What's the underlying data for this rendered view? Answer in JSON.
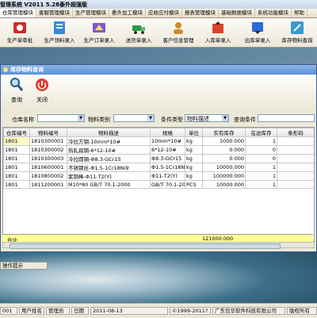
{
  "app": {
    "title": "管理系统  V2011 5.28泰外超强版"
  },
  "menu": {
    "tabs": [
      {
        "label": "仓库管理模块",
        "active": true
      },
      {
        "label": "客服管理模块",
        "active": false
      },
      {
        "label": "生产管理模块",
        "active": false
      },
      {
        "label": "委外加工模块",
        "active": false
      },
      {
        "label": "应收应付模块",
        "active": false
      },
      {
        "label": "报表管理模块",
        "active": false
      },
      {
        "label": "基础数据模块",
        "active": false
      },
      {
        "label": "系统功能模块",
        "active": false
      },
      {
        "label": "帮助",
        "active": false
      }
    ]
  },
  "toolbar": {
    "buttons": [
      {
        "label": "生产单审批",
        "icon": "approval-icon",
        "color": "#d02a2a"
      },
      {
        "label": "生产领料录入",
        "icon": "pick-material-icon",
        "color": "#3a8ad9"
      },
      {
        "label": "生产订单录入",
        "icon": "production-order-icon",
        "color": "#7a5ad0"
      },
      {
        "label": "送货单录入",
        "icon": "delivery-icon",
        "color": "#2d9a4a"
      },
      {
        "label": "客户信息管理",
        "icon": "customer-icon",
        "color": "#cc8a2a"
      },
      {
        "label": "入库单录入",
        "icon": "stock-in-icon",
        "color": "#d9442a"
      },
      {
        "label": "出库单录入",
        "icon": "stock-out-icon",
        "color": "#2a6ad9"
      },
      {
        "label": "库存物料查询",
        "icon": "inventory-query-icon",
        "color": "#3a9ad0"
      }
    ]
  },
  "window": {
    "title": "库存物料查询",
    "query_label": "查询",
    "close_label": "关闭"
  },
  "filters": {
    "warehouse_label": "仓库名称",
    "warehouse_value": "",
    "category_label": "物料类别",
    "category_value": "",
    "condition_type_label": "条件类型",
    "condition_type_value": "物料描述",
    "condition_label": "查询条件",
    "condition_value": ""
  },
  "table": {
    "columns": [
      "仓库编号",
      "物料编号",
      "物料描述",
      "规格",
      "单位",
      "实有库存",
      "在途库存",
      "条形码"
    ],
    "rows": [
      [
        "1801",
        "1810300001",
        "冷拉方钢-10mm*10#",
        "10mm*10#",
        "kg",
        "1000.000",
        "1",
        ""
      ],
      [
        "1801",
        "1810300002",
        "热轧扁钢-6*12-10#",
        "6*12-10#",
        "kg",
        "0.000",
        "0",
        ""
      ],
      [
        "1801",
        "1810300003",
        "冷拉圆钢-Φ8.3-GCr15",
        "Φ8.3-GCr15",
        "kg",
        "0.000",
        "0",
        ""
      ],
      [
        "1801",
        "1810600001",
        "不锈钢丝-Φ1.5-1Cr18Ni9",
        "Φ1.5-1Cr18Ni9",
        "kg",
        "10000.000",
        "1",
        ""
      ],
      [
        "1801",
        "1810800002",
        "紫铜棒-Φ11-T2(Y)",
        "Φ11-T2(Y)",
        "kg",
        "100000.000",
        "1",
        ""
      ],
      [
        "1801",
        "1811200001",
        "M10*80 GB/T 70.1-2000",
        "GB/T 70.1-200",
        "PCS",
        "10000.000",
        "1",
        ""
      ]
    ],
    "total_label": "合计",
    "total_stock": "121000.000"
  },
  "tip_tab": "操作提示",
  "status": {
    "user_id": "001",
    "user_name_label": "用户姓名",
    "user_name": "管理员",
    "date_label": "日期",
    "date": "2011-08-13",
    "copyright": "©1999-2011?",
    "company": "广东信华软件科技有限公司",
    "rights": "版权所有"
  },
  "colors": {
    "title_gradient": "#5a8fd6",
    "total_row": "#ffff99",
    "desktop": "#4d7391"
  }
}
